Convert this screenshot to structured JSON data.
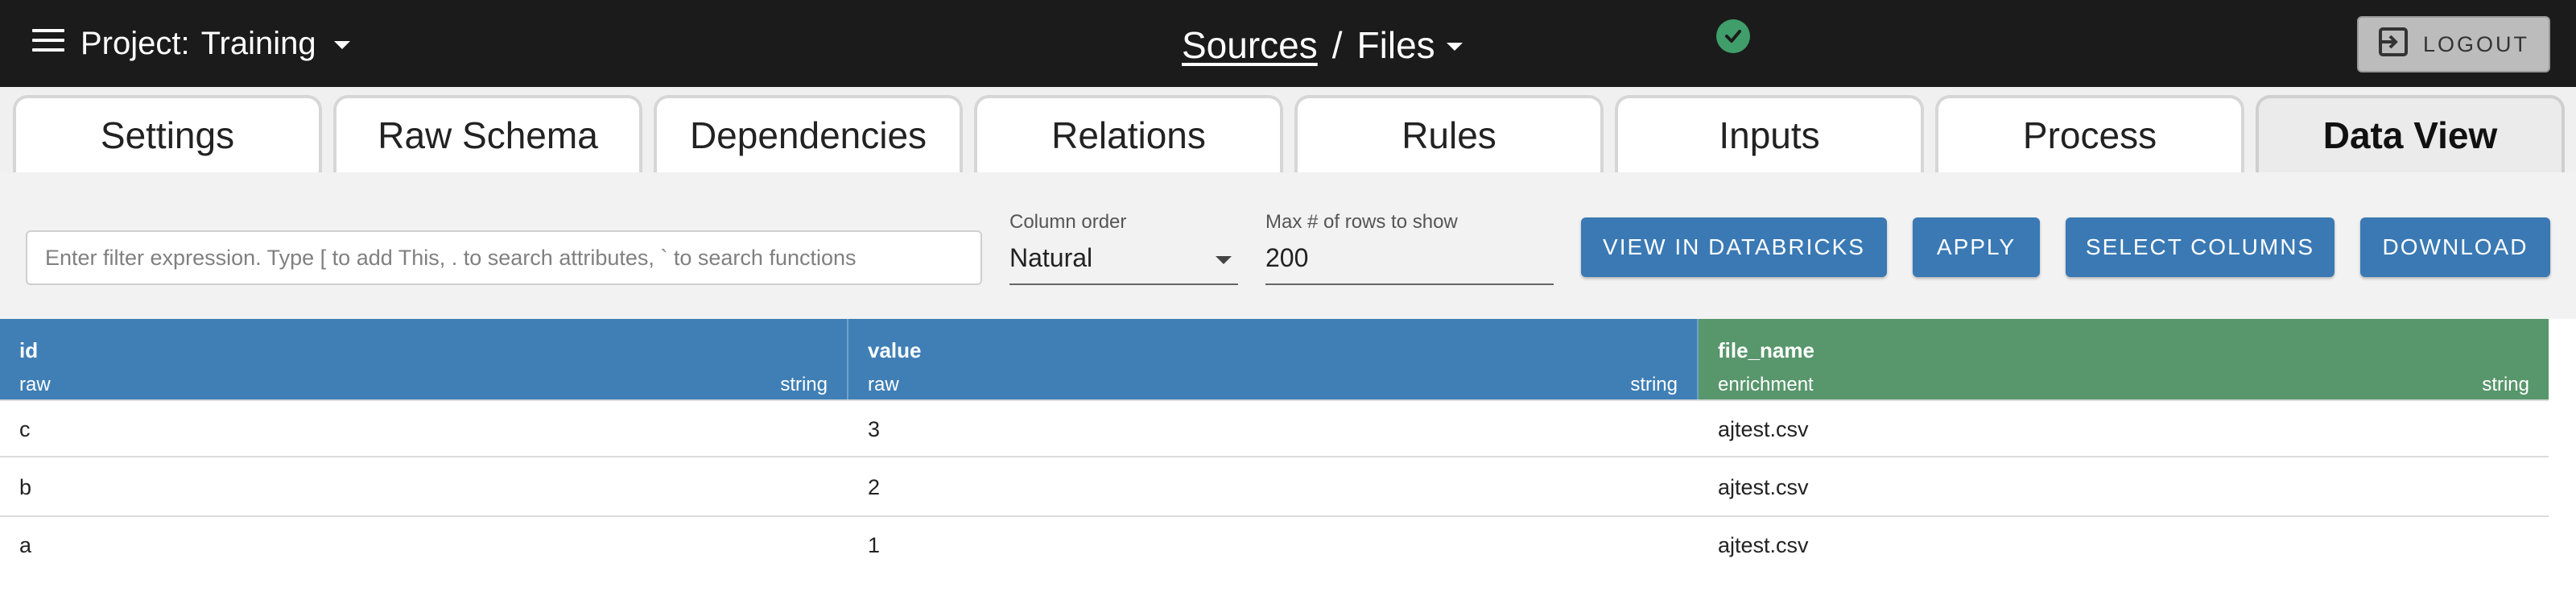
{
  "header": {
    "project_label": "Project:",
    "project_name": "Training",
    "breadcrumb_sources": "Sources",
    "breadcrumb_separator": "/",
    "breadcrumb_files": "Files",
    "logout_label": "LOGOUT",
    "status_color": "#3f9e6a"
  },
  "tabs": [
    {
      "label": "Settings"
    },
    {
      "label": "Raw Schema"
    },
    {
      "label": "Dependencies"
    },
    {
      "label": "Relations"
    },
    {
      "label": "Rules"
    },
    {
      "label": "Inputs"
    },
    {
      "label": "Process"
    },
    {
      "label": "Data View",
      "active": true
    }
  ],
  "toolbar": {
    "filter_placeholder": "Enter filter expression. Type [ to add This, . to search attributes, ` to search functions",
    "column_order_label": "Column order",
    "column_order_value": "Natural",
    "max_rows_label": "Max # of rows to show",
    "max_rows_value": "200",
    "buttons": {
      "view_in_databricks": "VIEW IN DATABRICKS",
      "apply": "APPLY",
      "select_columns": "SELECT COLUMNS",
      "download": "DOWNLOAD"
    },
    "button_color": "#3a79b4"
  },
  "table": {
    "columns": [
      {
        "name": "id",
        "source": "raw",
        "type": "string",
        "color": "#3f7fb5"
      },
      {
        "name": "value",
        "source": "raw",
        "type": "string",
        "color": "#3f7fb5"
      },
      {
        "name": "file_name",
        "source": "enrichment",
        "type": "string",
        "color": "#58966c"
      }
    ],
    "rows": [
      [
        "c",
        "3",
        "ajtest.csv"
      ],
      [
        "b",
        "2",
        "ajtest.csv"
      ],
      [
        "a",
        "1",
        "ajtest.csv"
      ]
    ]
  }
}
